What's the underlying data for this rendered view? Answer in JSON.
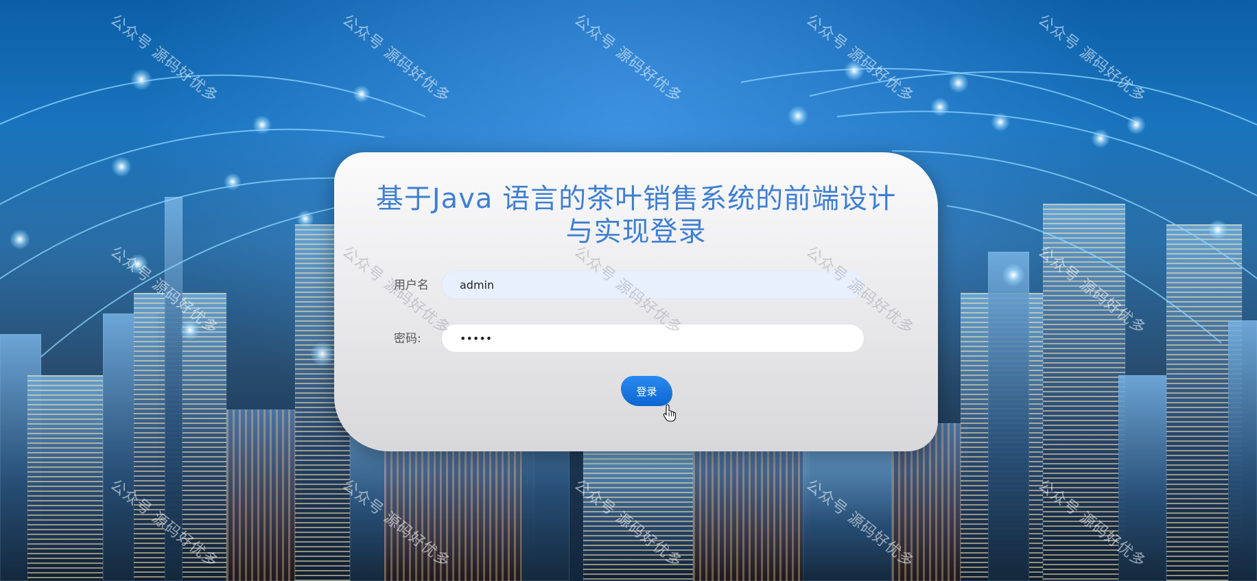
{
  "page": {
    "title": "基于Java 语言的茶叶销售系统的前端设计与实现登录",
    "title_line1": "基于Java 语言的茶叶销售系统的前端设计",
    "title_line2": "与实现登录"
  },
  "form": {
    "username_label": "用户名",
    "username_value": "admin",
    "password_label": "密码:",
    "password_value": "•••••"
  },
  "login_button": {
    "label": "登录"
  },
  "watermark": {
    "text": "公众号 源码好优多"
  },
  "colors": {
    "title": "#3f7fd0",
    "button": "#0c66cf",
    "background": "#1a74bd"
  },
  "icons": {
    "cursor": "hand-pointer-icon"
  }
}
